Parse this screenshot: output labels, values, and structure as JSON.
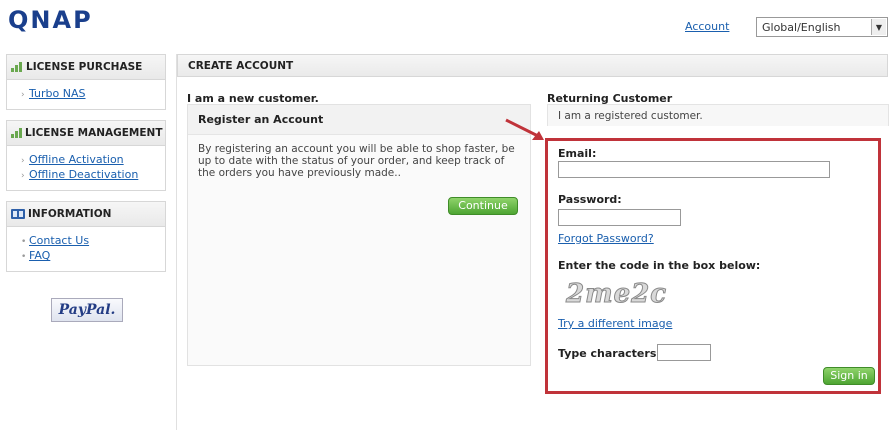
{
  "header": {
    "logo": "QNAP",
    "account_link": "Account",
    "language": "Global/English"
  },
  "sidebar": {
    "license_purchase": {
      "title": "LICENSE PURCHASE",
      "items": [
        {
          "label": "Turbo NAS"
        }
      ]
    },
    "license_management": {
      "title": "LICENSE MANAGEMENT",
      "items": [
        {
          "label": "Offline Activation"
        },
        {
          "label": "Offline Deactivation"
        }
      ]
    },
    "information": {
      "title": "INFORMATION",
      "items": [
        {
          "label": "Contact Us"
        },
        {
          "label": "FAQ"
        }
      ]
    },
    "paypal_logo": "PayPal."
  },
  "main": {
    "header": "CREATE ACCOUNT",
    "new_customer": {
      "title": "I am a new customer.",
      "box_title": "Register an Account",
      "description": "By registering an account you will be able to shop faster, be up to date with the status of your order, and keep track of the orders you have previously made..",
      "continue_button": "Continue"
    },
    "returning": {
      "title": "Returning Customer",
      "subtitle": "I am a registered customer.",
      "email_label": "Email:",
      "email_value": "",
      "password_label": "Password:",
      "password_value": "",
      "forgot_link": "Forgot Password?",
      "captcha_prompt": "Enter the code in the box below:",
      "captcha_image_text": "2me2c",
      "try_different_link": "Try a different image",
      "type_chars_label": "Type characters:",
      "type_chars_value": "",
      "sign_in_button": "Sign in"
    }
  },
  "colors": {
    "highlight_border": "#c0333a",
    "button_green": "#4ea532",
    "link_blue": "#1a5fae"
  }
}
